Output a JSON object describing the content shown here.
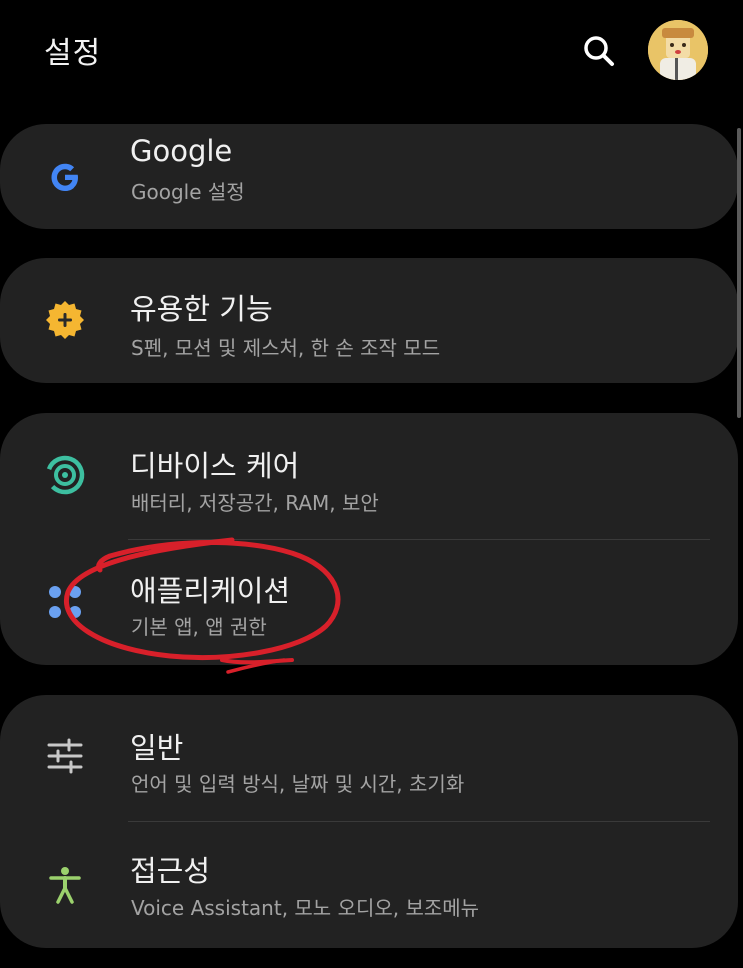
{
  "header": {
    "title": "설정"
  },
  "icons": {
    "search": "search-icon",
    "avatar": "profile-avatar"
  },
  "cards": [
    {
      "items": [
        {
          "title": "Google",
          "subtitle": "Google 설정",
          "icon": "google-icon"
        }
      ]
    },
    {
      "items": [
        {
          "title": "유용한 기능",
          "subtitle": "S펜, 모션 및 제스처, 한 손 조작 모드",
          "icon": "advanced-features-icon"
        }
      ]
    },
    {
      "items": [
        {
          "title": "디바이스 케어",
          "subtitle": "배터리, 저장공간, RAM, 보안",
          "icon": "device-care-icon"
        },
        {
          "title": "애플리케이션",
          "subtitle": "기본 앱, 앱 권한",
          "icon": "apps-icon"
        }
      ]
    },
    {
      "items": [
        {
          "title": "일반",
          "subtitle": "언어 및 입력 방식, 날짜 및 시간, 초기화",
          "icon": "general-sliders-icon"
        },
        {
          "title": "접근성",
          "subtitle": "Voice Assistant, 모노 오디오, 보조메뉴",
          "icon": "accessibility-icon"
        }
      ]
    }
  ],
  "colors": {
    "background": "#000000",
    "card": "#222222",
    "title": "#f0f0f0",
    "subtitle": "#a3a3a3",
    "google_blue": "#4285f4",
    "features_orange": "#f5b631",
    "device_care_teal": "#3dbfa0",
    "apps_blue": "#6aa0f0",
    "general_gray": "#c8c8c8",
    "accessibility_green": "#9bd16d",
    "annotation_red": "#d8202a"
  }
}
